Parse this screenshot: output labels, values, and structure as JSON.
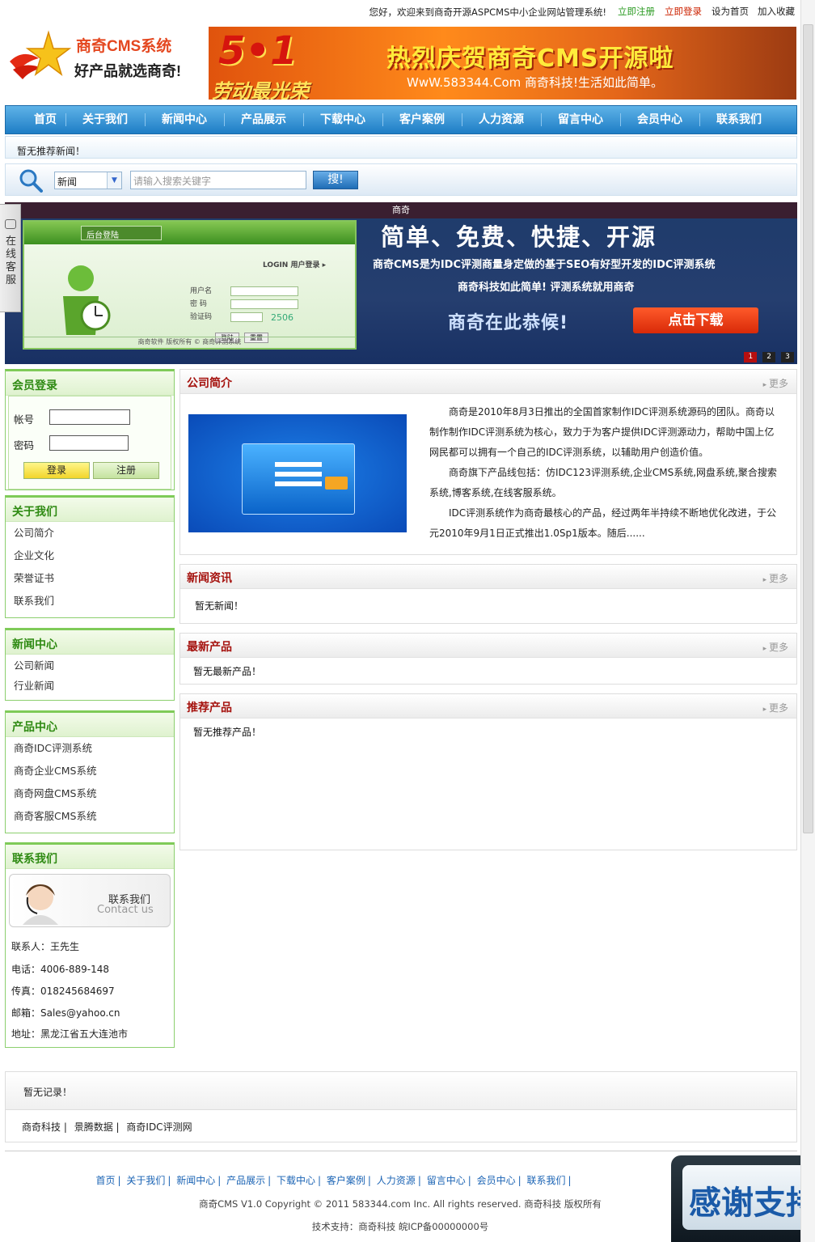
{
  "topbar": {
    "welcome": "您好，欢迎来到商奇开源ASPCMS中小企业网站管理系统!",
    "register": "立即注册",
    "login": "立即登录",
    "set_home": "设为首页",
    "favorite": "加入收藏"
  },
  "logo": {
    "line1": "商奇CMS系统",
    "line2": "好产品就选商奇!"
  },
  "banner": {
    "badge": "5•1",
    "title": "热烈庆贺商奇CMS开源啦",
    "slogan": "劳动最光荣",
    "url_line": "WwW.583344.Com 商奇科技!生活如此简单。"
  },
  "nav": [
    "首页",
    "关于我们",
    "新闻中心",
    "产品展示",
    "下载中心",
    "客户案例",
    "人力资源",
    "留言中心",
    "会员中心",
    "联系我们"
  ],
  "recommend_news": "暂无推荐新闻！",
  "search": {
    "category": "新闻",
    "placeholder": "请输入搜索关键字",
    "button": "搜!"
  },
  "side_tab": "在线客服",
  "slider": {
    "caption": "商奇",
    "panel_brand": "后台登陆",
    "panel_login": "LOGIN 用户登录 ▸",
    "panel_user": "用户名",
    "panel_pass": "密 码",
    "panel_code_label": "验证码",
    "panel_code": "2506",
    "panel_btn_login": "登陆",
    "panel_btn_reset": "重置",
    "panel_footer": "商奇软件 版权所有 © 商奇评测系统",
    "headline": "简单、免费、快捷、开源",
    "subline": "商奇CMS是为IDC评测商量身定做的基于SEO有好型开发的IDC评测系统",
    "tagline": "商奇科技如此简单! 评测系统就用商奇",
    "wait": "商奇在此恭候!",
    "download": "点击下载",
    "dots": [
      "1",
      "2",
      "3"
    ]
  },
  "member": {
    "title": "会员登录",
    "account": "帐号",
    "password": "密码",
    "login_btn": "登录",
    "register_btn": "注册"
  },
  "about_menu": {
    "title": "关于我们",
    "items": [
      "公司简介",
      "企业文化",
      "荣誉证书",
      "联系我们"
    ]
  },
  "news_menu": {
    "title": "新闻中心",
    "items": [
      "公司新闻",
      "行业新闻"
    ]
  },
  "product_menu": {
    "title": "产品中心",
    "items": [
      "商奇IDC评测系统",
      "商奇企业CMS系统",
      "商奇网盘CMS系统",
      "商奇客服CMS系统"
    ]
  },
  "contact": {
    "title": "联系我们",
    "img_cn": "联系我们",
    "img_en": "Contact us",
    "person": "联系人：王先生",
    "phone": "电话：4006-889-148",
    "fax": "传真：018245684697",
    "email": "邮箱：Sales@yahoo.cn",
    "address": "地址：黑龙江省五大连池市"
  },
  "company": {
    "title": "公司简介",
    "more": "更多",
    "p1": "商奇是2010年8月3日推出的全国首家制作IDC评测系统源码的团队。商奇以制作制作IDC评测系统为核心，致力于为客户提供IDC评测源动力，帮助中国上亿网民都可以拥有一个自己的IDC评测系统，以辅助用户创造价值。",
    "p2": "商奇旗下产品线包括：仿IDC123评测系统,企业CMS系统,网盘系统,聚合搜索系统,博客系统,在线客服系统。",
    "p3": "IDC评测系统作为商奇最核心的产品，经过两年半持续不断地优化改进，于公元2010年9月1日正式推出1.0Sp1版本。随后......"
  },
  "news": {
    "title": "新闻资讯",
    "more": "更多",
    "empty": "暂无新闻！"
  },
  "latest": {
    "title": "最新产品",
    "more": "更多",
    "empty": "暂无最新产品！"
  },
  "recommend": {
    "title": "推荐产品",
    "more": "更多",
    "empty": "暂无推荐产品！"
  },
  "footer": {
    "records": "暂无记录！",
    "links": [
      "商奇科技",
      "景腾数据",
      "商奇IDC评测网"
    ],
    "nav": [
      "首页",
      "关于我们",
      "新闻中心",
      "产品展示",
      "下载中心",
      "客户案例",
      "人力资源",
      "留言中心",
      "会员中心",
      "联系我们"
    ],
    "copyright": "商奇CMS V1.0 Copyright © 2011 583344.com Inc. All rights reserved. 商奇科技 版权所有",
    "support": "技术支持：商奇科技 皖ICP备00000000号",
    "thanks": "感谢支持"
  }
}
